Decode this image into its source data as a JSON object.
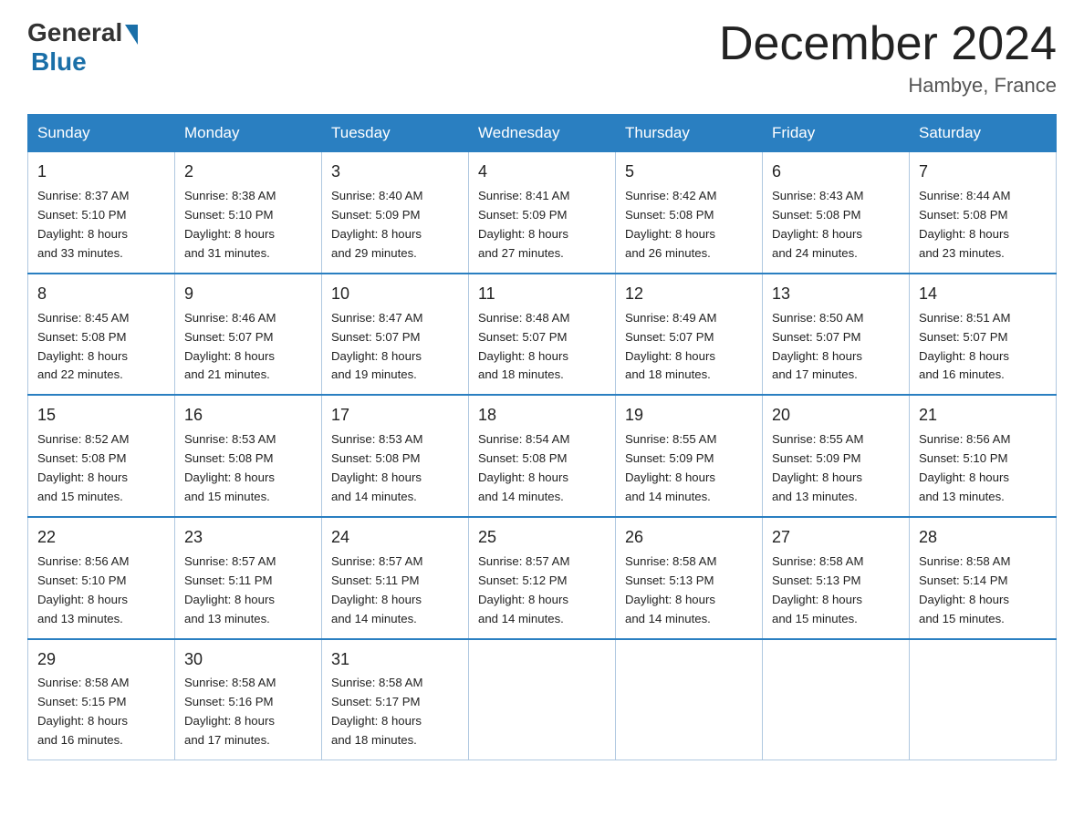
{
  "header": {
    "logo_general": "General",
    "logo_blue": "Blue",
    "month": "December 2024",
    "location": "Hambye, France"
  },
  "weekdays": [
    "Sunday",
    "Monday",
    "Tuesday",
    "Wednesday",
    "Thursday",
    "Friday",
    "Saturday"
  ],
  "weeks": [
    [
      {
        "num": "1",
        "sunrise": "8:37 AM",
        "sunset": "5:10 PM",
        "daylight": "8 hours and 33 minutes."
      },
      {
        "num": "2",
        "sunrise": "8:38 AM",
        "sunset": "5:10 PM",
        "daylight": "8 hours and 31 minutes."
      },
      {
        "num": "3",
        "sunrise": "8:40 AM",
        "sunset": "5:09 PM",
        "daylight": "8 hours and 29 minutes."
      },
      {
        "num": "4",
        "sunrise": "8:41 AM",
        "sunset": "5:09 PM",
        "daylight": "8 hours and 27 minutes."
      },
      {
        "num": "5",
        "sunrise": "8:42 AM",
        "sunset": "5:08 PM",
        "daylight": "8 hours and 26 minutes."
      },
      {
        "num": "6",
        "sunrise": "8:43 AM",
        "sunset": "5:08 PM",
        "daylight": "8 hours and 24 minutes."
      },
      {
        "num": "7",
        "sunrise": "8:44 AM",
        "sunset": "5:08 PM",
        "daylight": "8 hours and 23 minutes."
      }
    ],
    [
      {
        "num": "8",
        "sunrise": "8:45 AM",
        "sunset": "5:08 PM",
        "daylight": "8 hours and 22 minutes."
      },
      {
        "num": "9",
        "sunrise": "8:46 AM",
        "sunset": "5:07 PM",
        "daylight": "8 hours and 21 minutes."
      },
      {
        "num": "10",
        "sunrise": "8:47 AM",
        "sunset": "5:07 PM",
        "daylight": "8 hours and 19 minutes."
      },
      {
        "num": "11",
        "sunrise": "8:48 AM",
        "sunset": "5:07 PM",
        "daylight": "8 hours and 18 minutes."
      },
      {
        "num": "12",
        "sunrise": "8:49 AM",
        "sunset": "5:07 PM",
        "daylight": "8 hours and 18 minutes."
      },
      {
        "num": "13",
        "sunrise": "8:50 AM",
        "sunset": "5:07 PM",
        "daylight": "8 hours and 17 minutes."
      },
      {
        "num": "14",
        "sunrise": "8:51 AM",
        "sunset": "5:07 PM",
        "daylight": "8 hours and 16 minutes."
      }
    ],
    [
      {
        "num": "15",
        "sunrise": "8:52 AM",
        "sunset": "5:08 PM",
        "daylight": "8 hours and 15 minutes."
      },
      {
        "num": "16",
        "sunrise": "8:53 AM",
        "sunset": "5:08 PM",
        "daylight": "8 hours and 15 minutes."
      },
      {
        "num": "17",
        "sunrise": "8:53 AM",
        "sunset": "5:08 PM",
        "daylight": "8 hours and 14 minutes."
      },
      {
        "num": "18",
        "sunrise": "8:54 AM",
        "sunset": "5:08 PM",
        "daylight": "8 hours and 14 minutes."
      },
      {
        "num": "19",
        "sunrise": "8:55 AM",
        "sunset": "5:09 PM",
        "daylight": "8 hours and 14 minutes."
      },
      {
        "num": "20",
        "sunrise": "8:55 AM",
        "sunset": "5:09 PM",
        "daylight": "8 hours and 13 minutes."
      },
      {
        "num": "21",
        "sunrise": "8:56 AM",
        "sunset": "5:10 PM",
        "daylight": "8 hours and 13 minutes."
      }
    ],
    [
      {
        "num": "22",
        "sunrise": "8:56 AM",
        "sunset": "5:10 PM",
        "daylight": "8 hours and 13 minutes."
      },
      {
        "num": "23",
        "sunrise": "8:57 AM",
        "sunset": "5:11 PM",
        "daylight": "8 hours and 13 minutes."
      },
      {
        "num": "24",
        "sunrise": "8:57 AM",
        "sunset": "5:11 PM",
        "daylight": "8 hours and 14 minutes."
      },
      {
        "num": "25",
        "sunrise": "8:57 AM",
        "sunset": "5:12 PM",
        "daylight": "8 hours and 14 minutes."
      },
      {
        "num": "26",
        "sunrise": "8:58 AM",
        "sunset": "5:13 PM",
        "daylight": "8 hours and 14 minutes."
      },
      {
        "num": "27",
        "sunrise": "8:58 AM",
        "sunset": "5:13 PM",
        "daylight": "8 hours and 15 minutes."
      },
      {
        "num": "28",
        "sunrise": "8:58 AM",
        "sunset": "5:14 PM",
        "daylight": "8 hours and 15 minutes."
      }
    ],
    [
      {
        "num": "29",
        "sunrise": "8:58 AM",
        "sunset": "5:15 PM",
        "daylight": "8 hours and 16 minutes."
      },
      {
        "num": "30",
        "sunrise": "8:58 AM",
        "sunset": "5:16 PM",
        "daylight": "8 hours and 17 minutes."
      },
      {
        "num": "31",
        "sunrise": "8:58 AM",
        "sunset": "5:17 PM",
        "daylight": "8 hours and 18 minutes."
      },
      null,
      null,
      null,
      null
    ]
  ],
  "labels": {
    "sunrise": "Sunrise:",
    "sunset": "Sunset:",
    "daylight": "Daylight:"
  }
}
